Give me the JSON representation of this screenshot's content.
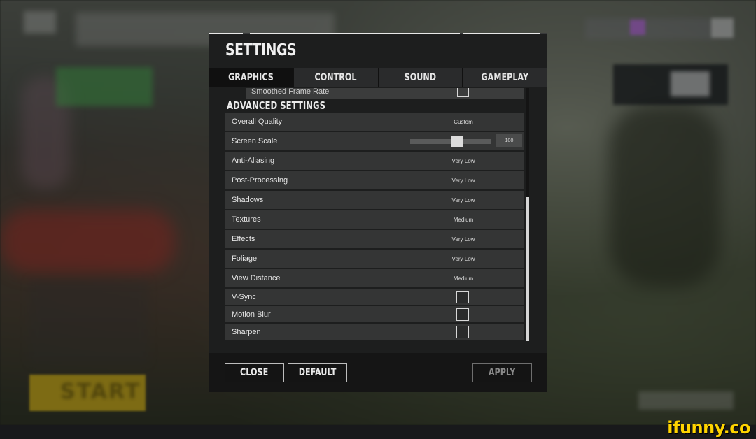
{
  "dialog": {
    "title": "SETTINGS",
    "tabs": [
      {
        "label": "GRAPHICS",
        "active": true
      },
      {
        "label": "CONTROL",
        "active": false
      },
      {
        "label": "SOUND",
        "active": false
      },
      {
        "label": "GAMEPLAY",
        "active": false
      }
    ],
    "partial_row_label": "Smoothed Frame Rate",
    "section_title": "ADVANCED SETTINGS",
    "rows": {
      "overall_quality": {
        "label": "Overall Quality",
        "value": "Custom"
      },
      "screen_scale": {
        "label": "Screen Scale",
        "value": "100",
        "slider_percent": 60
      },
      "anti_aliasing": {
        "label": "Anti-Aliasing",
        "value": "Very Low"
      },
      "post_processing": {
        "label": "Post-Processing",
        "value": "Very Low"
      },
      "shadows": {
        "label": "Shadows",
        "value": "Very Low"
      },
      "textures": {
        "label": "Textures",
        "value": "Medium"
      },
      "effects": {
        "label": "Effects",
        "value": "Very Low"
      },
      "foliage": {
        "label": "Foliage",
        "value": "Very Low"
      },
      "view_distance": {
        "label": "View Distance",
        "value": "Medium"
      },
      "vsync": {
        "label": "V-Sync",
        "checked": false
      },
      "motion_blur": {
        "label": "Motion Blur",
        "checked": false
      },
      "sharpen": {
        "label": "Sharpen",
        "checked": false
      }
    },
    "buttons": {
      "close": "CLOSE",
      "default": "DEFAULT",
      "apply": "APPLY"
    }
  },
  "background": {
    "start_label": "START"
  },
  "watermark": "ifunny.co",
  "colors": {
    "panel_bg": "#1d1e1e",
    "row_bg": "#343535",
    "active_tab_bg": "#101010",
    "watermark": "#ffd400"
  }
}
